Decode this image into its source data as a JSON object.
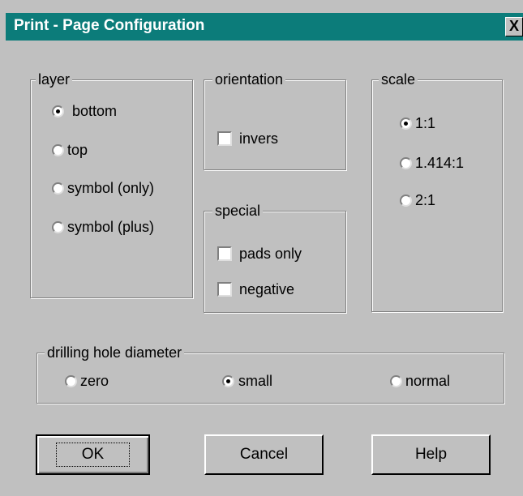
{
  "window": {
    "title": "Print - Page Configuration",
    "close_label": "X"
  },
  "layer": {
    "legend": "layer",
    "options": [
      {
        "label": "bottom",
        "selected": true
      },
      {
        "label": "top",
        "selected": false
      },
      {
        "label": "symbol (only)",
        "selected": false
      },
      {
        "label": "symbol (plus)",
        "selected": false
      }
    ]
  },
  "orientation": {
    "legend": "orientation",
    "options": [
      {
        "label": "invers",
        "checked": false
      }
    ]
  },
  "special": {
    "legend": "special",
    "options": [
      {
        "label": "pads only",
        "checked": false
      },
      {
        "label": "negative",
        "checked": false
      }
    ]
  },
  "scale": {
    "legend": "scale",
    "options": [
      {
        "label": "1:1",
        "selected": true
      },
      {
        "label": "1.414:1",
        "selected": false
      },
      {
        "label": "2:1",
        "selected": false
      }
    ]
  },
  "drilling": {
    "legend": "drilling hole diameter",
    "options": [
      {
        "label": "zero",
        "selected": false
      },
      {
        "label": "small",
        "selected": true
      },
      {
        "label": "normal",
        "selected": false
      }
    ]
  },
  "buttons": {
    "ok": "OK",
    "cancel": "Cancel",
    "help": "Help"
  }
}
